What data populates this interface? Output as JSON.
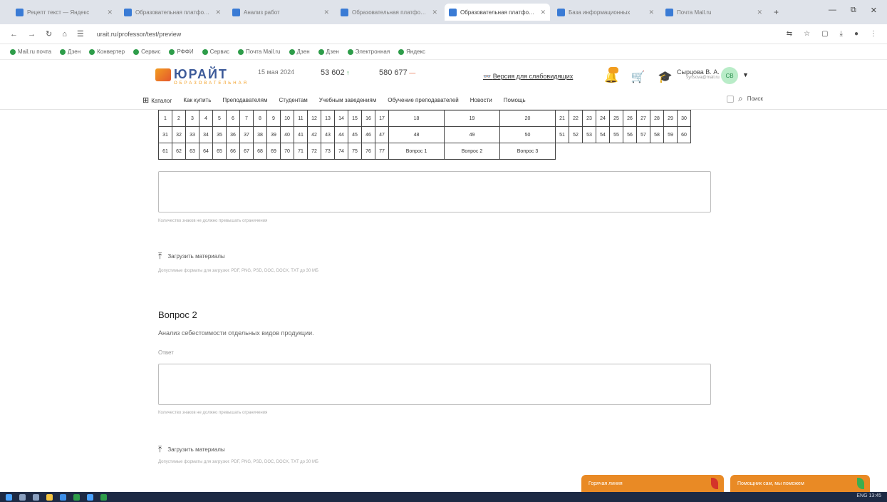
{
  "browser": {
    "tabs": [
      {
        "label": "Рецепт текст — Яндекс",
        "active": false
      },
      {
        "label": "Образовательная платформа",
        "active": false
      },
      {
        "label": "Анализ работ",
        "active": false
      },
      {
        "label": "Образовательная платформа",
        "active": false
      },
      {
        "label": "Образовательная платформа",
        "active": true
      },
      {
        "label": "База информационных",
        "active": false
      },
      {
        "label": "Почта Mail.ru",
        "active": false
      }
    ],
    "new_tab": "+",
    "url": "urait.ru/professor/test/preview",
    "window_controls": [
      "—",
      "⧉",
      "✕"
    ],
    "bookmarks": [
      "Mail.ru почта",
      "Дзен",
      "Конвертер",
      "Сервис",
      "РФФИ",
      "Сервис",
      "Почта Mail.ru",
      "Дзен",
      "Дзен",
      "Электронная",
      "Яндекс"
    ]
  },
  "header": {
    "logo_text": "ЮРАЙТ",
    "logo_sub": "ОБРАЗОВАТЕЛЬНАЯ",
    "date": "15 мая 2024",
    "stat1_value": "53 602",
    "stat1_delta": "↑",
    "stat2_value": "580 677",
    "stat2_delta": "—",
    "blind_label": "Версия для слабовидящих",
    "user_name": "Сырцова В. А.",
    "user_mail": "syrtsova@mail.ru",
    "avatar_initials": "СВ",
    "menu": [
      "Каталог",
      "Как купить",
      "Преподавателям",
      "Студентам",
      "Учебным заведениям",
      "Обучение преподавателей",
      "Новости",
      "Помощь"
    ],
    "search_label": "Поиск"
  },
  "grid": {
    "row1": [
      "1",
      "2",
      "3",
      "4",
      "5",
      "6",
      "7",
      "8",
      "9",
      "10",
      "11",
      "12",
      "13",
      "14",
      "15",
      "16",
      "17",
      "18",
      "19",
      "20",
      "21",
      "22",
      "23",
      "24",
      "25",
      "26",
      "27",
      "28",
      "29",
      "30"
    ],
    "row2": [
      "31",
      "32",
      "33",
      "34",
      "35",
      "36",
      "37",
      "38",
      "39",
      "40",
      "41",
      "42",
      "43",
      "44",
      "45",
      "46",
      "47",
      "48",
      "49",
      "50",
      "51",
      "52",
      "53",
      "54",
      "55",
      "56",
      "57",
      "58",
      "59",
      "60"
    ],
    "row3": [
      "61",
      "62",
      "63",
      "64",
      "65",
      "66",
      "67",
      "68",
      "69",
      "70",
      "71",
      "72",
      "73",
      "74",
      "75",
      "76",
      "77"
    ],
    "row3_questions": [
      "Вопрос 1",
      "Вопрос 2",
      "Вопрос 3"
    ]
  },
  "q1": {
    "hint": "Количество знаков не должно превышать ограничения",
    "upload_label": "Загрузить материалы",
    "formats": "Допустимые форматы для загрузки: PDF, PNG, PSD, DOC, DOCX, TXT до 30 МБ"
  },
  "q2": {
    "title": "Вопрос 2",
    "text": "Анализ себестоимости отдельных видов продукции.",
    "answer_label": "Ответ",
    "hint": "Количество знаков не должно превышать ограничения",
    "upload_label": "Загрузить материалы",
    "formats": "Допустимые форматы для загрузки: PDF, PNG, PSD, DOC, DOCX, TXT до 30 МБ"
  },
  "float_buttons": {
    "left": "Горячая линия",
    "right": "Помощник сам, мы поможем"
  },
  "taskbar": {
    "tray": "ENG 13:45"
  },
  "colors": {
    "accent": "#e98a25",
    "brand": "#3c5a99",
    "green": "#2e9d4a"
  }
}
